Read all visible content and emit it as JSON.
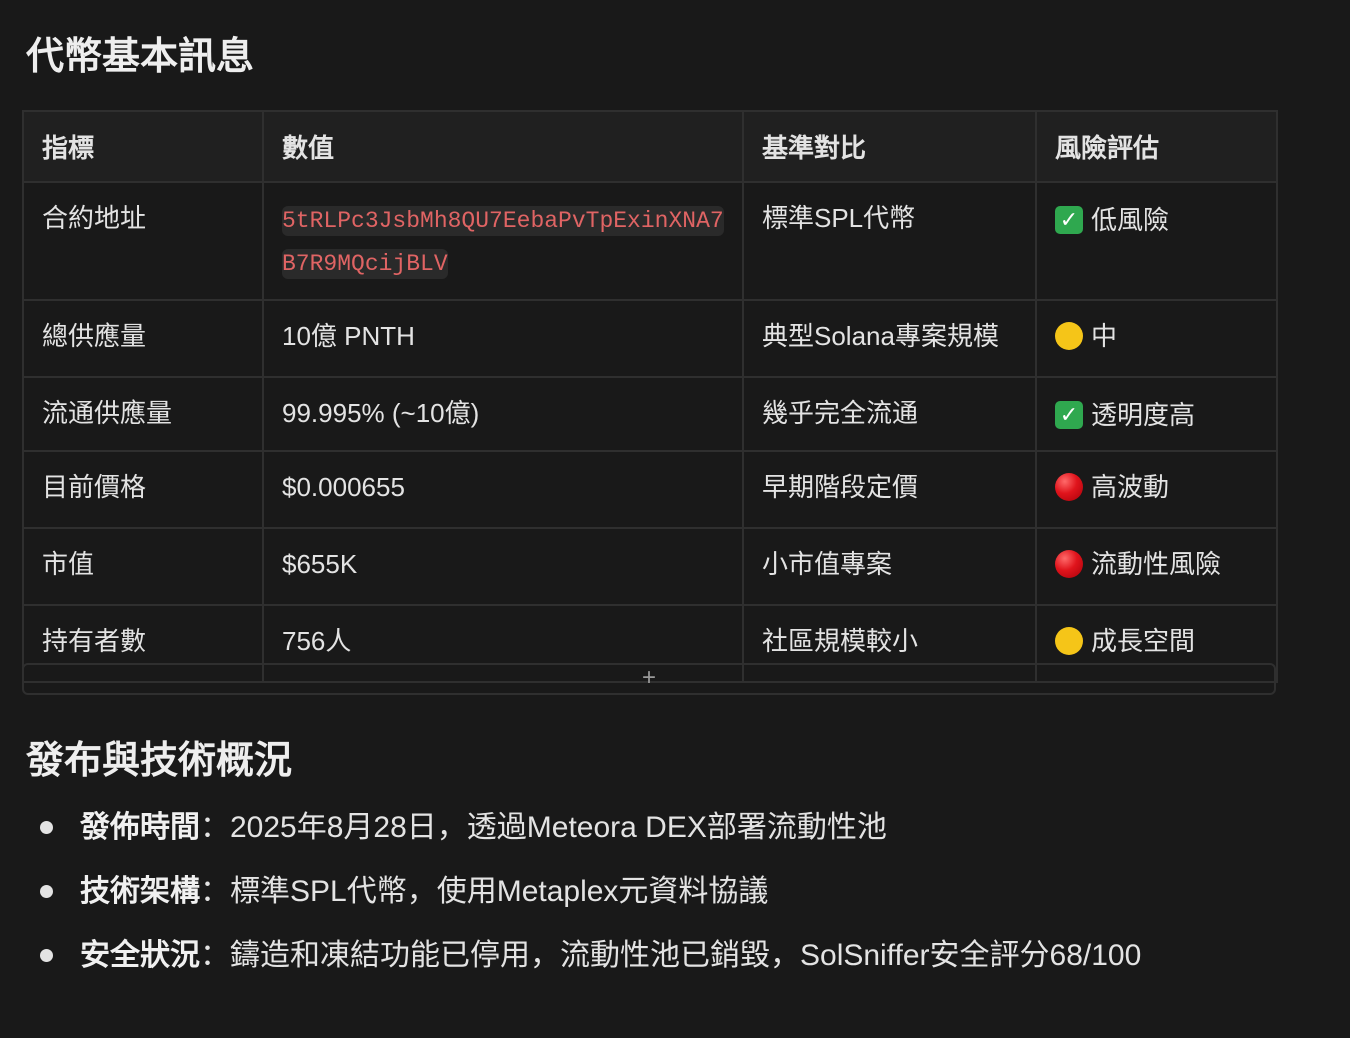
{
  "section1": {
    "title": "代幣基本訊息",
    "headers": [
      "指標",
      "數值",
      "基準對比",
      "風險評估"
    ],
    "rows": [
      {
        "metric": "合約地址",
        "value": "5tRLPc3JsbMh8QU7EebaPvTpExinXNA7B7R9MQcijBLV",
        "benchmark": "標準SPL代幣",
        "risk_icon": "check-icon",
        "risk": "低風險"
      },
      {
        "metric": "總供應量",
        "value": "10億 PNTH",
        "benchmark": "典型Solana專案規模",
        "risk_icon": "yellow-circle-icon",
        "risk": "中"
      },
      {
        "metric": "流通供應量",
        "value": "99.995% (~10億)",
        "benchmark": "幾乎完全流通",
        "risk_icon": "check-icon",
        "risk": "透明度高"
      },
      {
        "metric": "目前價格",
        "value": "$0.000655",
        "benchmark": "早期階段定價",
        "risk_icon": "red-circle-icon",
        "risk": "高波動"
      },
      {
        "metric": "市值",
        "value": "$655K",
        "benchmark": "小市值專案",
        "risk_icon": "red-circle-icon",
        "risk": "流動性風險"
      },
      {
        "metric": "持有者數",
        "value": "756人",
        "benchmark": "社區規模較小",
        "risk_icon": "yellow-circle-icon",
        "risk": "成長空間"
      }
    ],
    "add_row_label": "+"
  },
  "section2": {
    "title": "發布與技術概況",
    "items": [
      {
        "label": "發佈時間",
        "sep": "：",
        "text": "2025年8月28日，透過Meteora DEX部署流動性池"
      },
      {
        "label": "技術架構",
        "sep": "：",
        "text": "標準SPL代幣，使用Metaplex元資料協議"
      },
      {
        "label": "安全狀況",
        "sep": "：",
        "text": "鑄造和凍結功能已停用，流動性池已銷毀，SolSniffer安全評分68/100"
      }
    ]
  },
  "colors": {
    "background": "#191919",
    "text": "#e3e3e3",
    "code": "#e06464",
    "check": "#2fa84f",
    "yellow": "#f5c518",
    "red": "#e0141c"
  }
}
